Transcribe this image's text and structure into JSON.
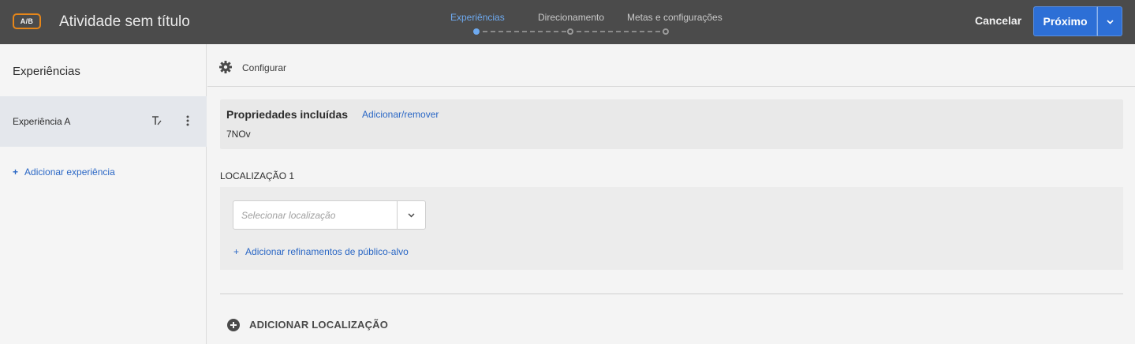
{
  "header": {
    "badge": "A/B",
    "title": "Atividade sem título",
    "steps": [
      {
        "label": "Experiências",
        "active": true
      },
      {
        "label": "Direcionamento",
        "active": false
      },
      {
        "label": "Metas e configurações",
        "active": false
      }
    ],
    "cancel_label": "Cancelar",
    "next_label": "Próximo"
  },
  "sidebar": {
    "title": "Experiências",
    "experiences": [
      {
        "label": "Experiência A",
        "selected": true
      }
    ],
    "add_experience": "Adicionar experiência",
    "add_icon": "+"
  },
  "main": {
    "configure_label": "Configurar",
    "properties": {
      "title": "Propriedades incluídas",
      "link": "Adicionar/remover",
      "value": "7NOv"
    },
    "location": {
      "label": "LOCALIZAÇÃO 1",
      "select_placeholder": "Selecionar localização",
      "refine_link": "Adicionar refinamentos de público-alvo",
      "refine_icon": "+"
    },
    "add_location": "ADICIONAR LOCALIZAÇÃO"
  },
  "colors": {
    "topbar": "#4b4b4b",
    "accent": "#2d6fd6",
    "active_step": "#6eaaf0",
    "badge_border": "#e68619",
    "link": "#2a67c5"
  }
}
